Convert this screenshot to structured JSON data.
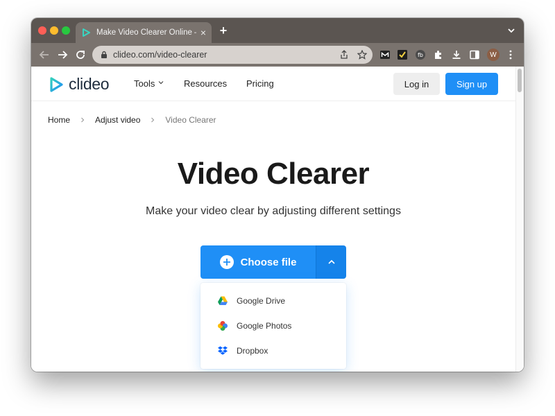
{
  "browser": {
    "tab_title": "Make Video Clearer Online — Clideo",
    "new_tab": "+",
    "tab_close": "×",
    "url": "clideo.com/video-clearer",
    "avatar_initial": "W"
  },
  "header": {
    "logo_text": "clideo",
    "nav": [
      "Tools",
      "Resources",
      "Pricing"
    ],
    "login_label": "Log in",
    "signup_label": "Sign up"
  },
  "breadcrumb": [
    "Home",
    "Adjust video",
    "Video Clearer"
  ],
  "hero": {
    "title": "Video Clearer",
    "subtitle": "Make your video clear by adjusting different settings"
  },
  "upload": {
    "choose_label": "Choose file",
    "options": [
      "Google Drive",
      "Google Photos",
      "Dropbox"
    ]
  },
  "colors": {
    "accent": "#1f8ff6",
    "tabstrip": "#5b5551",
    "toolbar": "#7a736e"
  }
}
